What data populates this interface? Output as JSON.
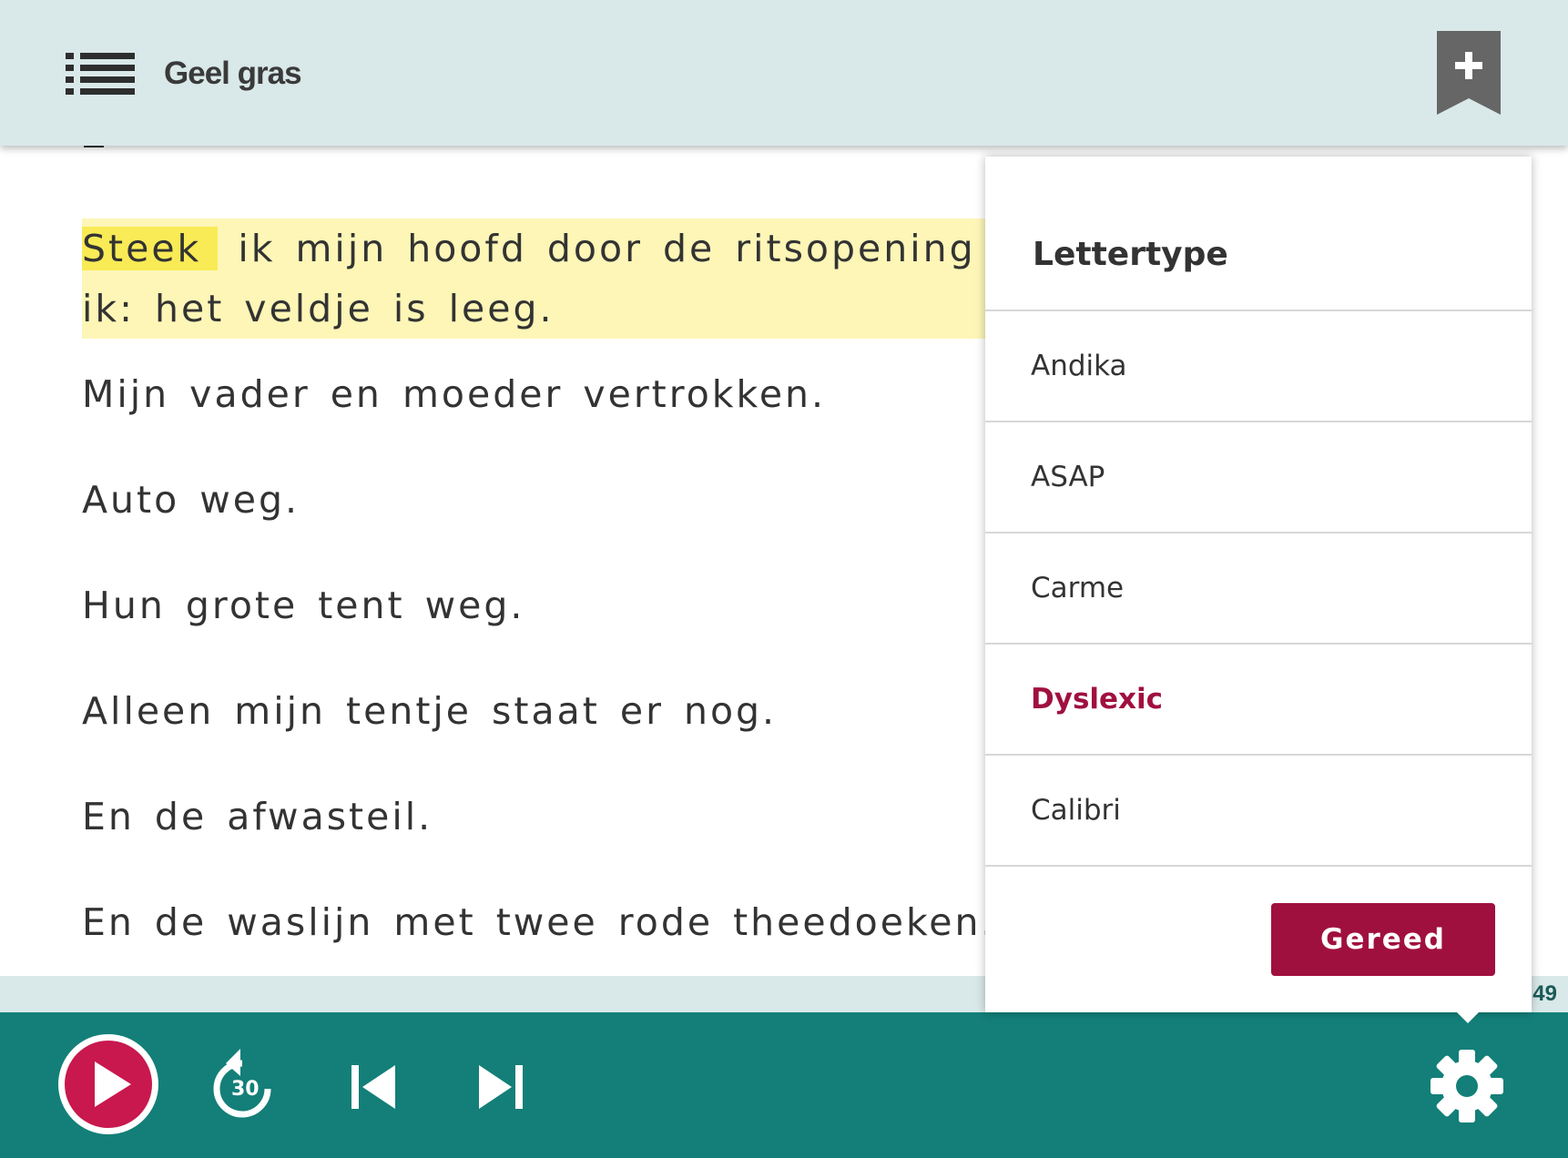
{
  "header": {
    "menu_icon": "list-icon",
    "title": "Geel gras",
    "bookmark_icon": "bookmark-add-icon"
  },
  "reader": {
    "current_paragraph": {
      "active_word": "Steek",
      "rest_line1": " ik mijn hoofd door de ritsopening van",
      "line2": "ik: het veldje is leeg."
    },
    "paragraphs": [
      "Mijn vader en moeder vertrokken.",
      "Auto weg.",
      "Hun grote tent weg.",
      "Alleen mijn tentje staat er nog.",
      "En de afwasteil.",
      "En de waslijn met twee rode theedoeken."
    ],
    "page_number": "49",
    "highlight_color": "#fdf6b7",
    "active_word_color": "#f9eb55"
  },
  "font_menu": {
    "title": "Lettertype",
    "options": [
      {
        "label": "Andika",
        "selected": false
      },
      {
        "label": "ASAP",
        "selected": false
      },
      {
        "label": "Carme",
        "selected": false
      },
      {
        "label": "Dyslexic",
        "selected": true
      },
      {
        "label": "Calibri",
        "selected": false
      }
    ],
    "done_label": "Gereed",
    "accent_color": "#a0103f"
  },
  "player": {
    "background_color": "#137f78",
    "play_icon": "play-icon",
    "rewind_icon": "rewind-30-icon",
    "rewind_label": "30",
    "prev_icon": "skip-previous-icon",
    "next_icon": "skip-next-icon",
    "settings_icon": "gear-icon"
  }
}
